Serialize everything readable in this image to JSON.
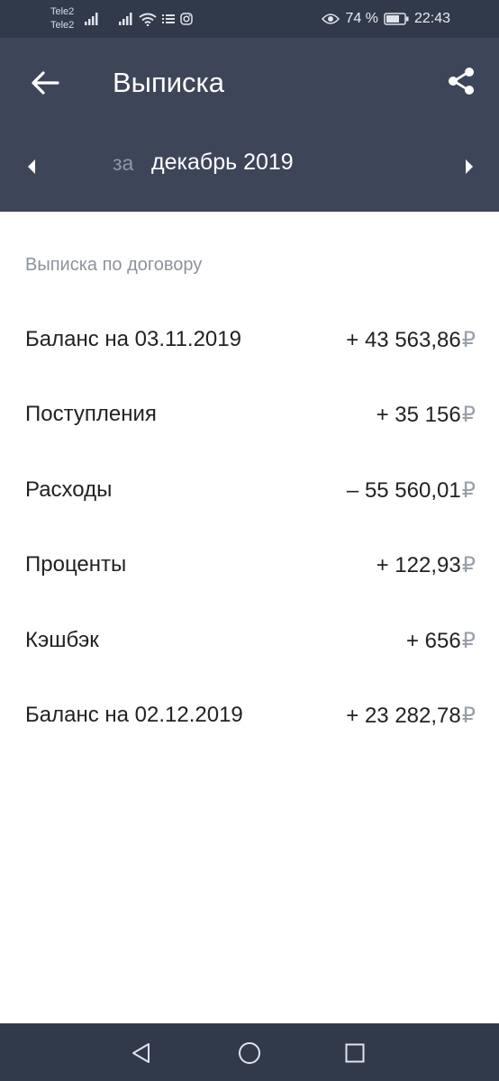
{
  "status_bar": {
    "carrier_1": "Tele2",
    "carrier_2": "Tele2",
    "battery": "74 %",
    "time": "22:43"
  },
  "header": {
    "title": "Выписка",
    "period_prefix": "за",
    "period": "декабрь 2019"
  },
  "main": {
    "section_label": "Выписка по договору",
    "currency": "₽",
    "rows": [
      {
        "label": "Баланс на 03.11.2019",
        "value": "+ 43 563,86"
      },
      {
        "label": "Поступления",
        "value": "+ 35 156"
      },
      {
        "label": "Расходы",
        "value": "– 55 560,01"
      },
      {
        "label": "Проценты",
        "value": "+ 122,93"
      },
      {
        "label": "Кэшбэк",
        "value": "+ 656"
      },
      {
        "label": "Баланс на 02.12.2019",
        "value": "+ 23 282,78"
      }
    ]
  },
  "icons": {
    "back": "arrow-left-icon",
    "share": "share-icon",
    "prev": "triangle-left-icon",
    "next": "triangle-right-icon",
    "nav_back": "triangle-back-icon",
    "nav_home": "circle-home-icon",
    "nav_recents": "square-recents-icon"
  },
  "colors": {
    "status_bar": "#313a4b",
    "header": "#3d4659",
    "background": "#ffffff"
  }
}
